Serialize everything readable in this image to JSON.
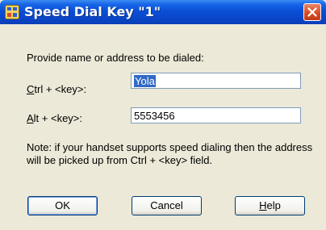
{
  "window": {
    "title": "Speed Dial Key \"1\""
  },
  "icons": {
    "app": "speed-dial-app-icon",
    "close": "close-icon"
  },
  "colors": {
    "titlebar": "#0A4FD6",
    "dialog_background": "#ECE9D8",
    "close_button": "#D64A23",
    "selection": "#316AC5"
  },
  "form": {
    "prompt": "Provide name or address to be dialed:",
    "ctrl": {
      "label_mnemonic": "C",
      "label_rest": "trl + <key>:",
      "value": "Yola"
    },
    "alt": {
      "label_mnemonic": "A",
      "label_rest": "lt + <key>:",
      "value": "5553456"
    },
    "note": "Note: if your handset supports speed dialing then the address will be picked up from Ctrl + <key> field."
  },
  "buttons": {
    "ok": "OK",
    "cancel": "Cancel",
    "help_mnemonic": "H",
    "help_rest": "elp"
  }
}
